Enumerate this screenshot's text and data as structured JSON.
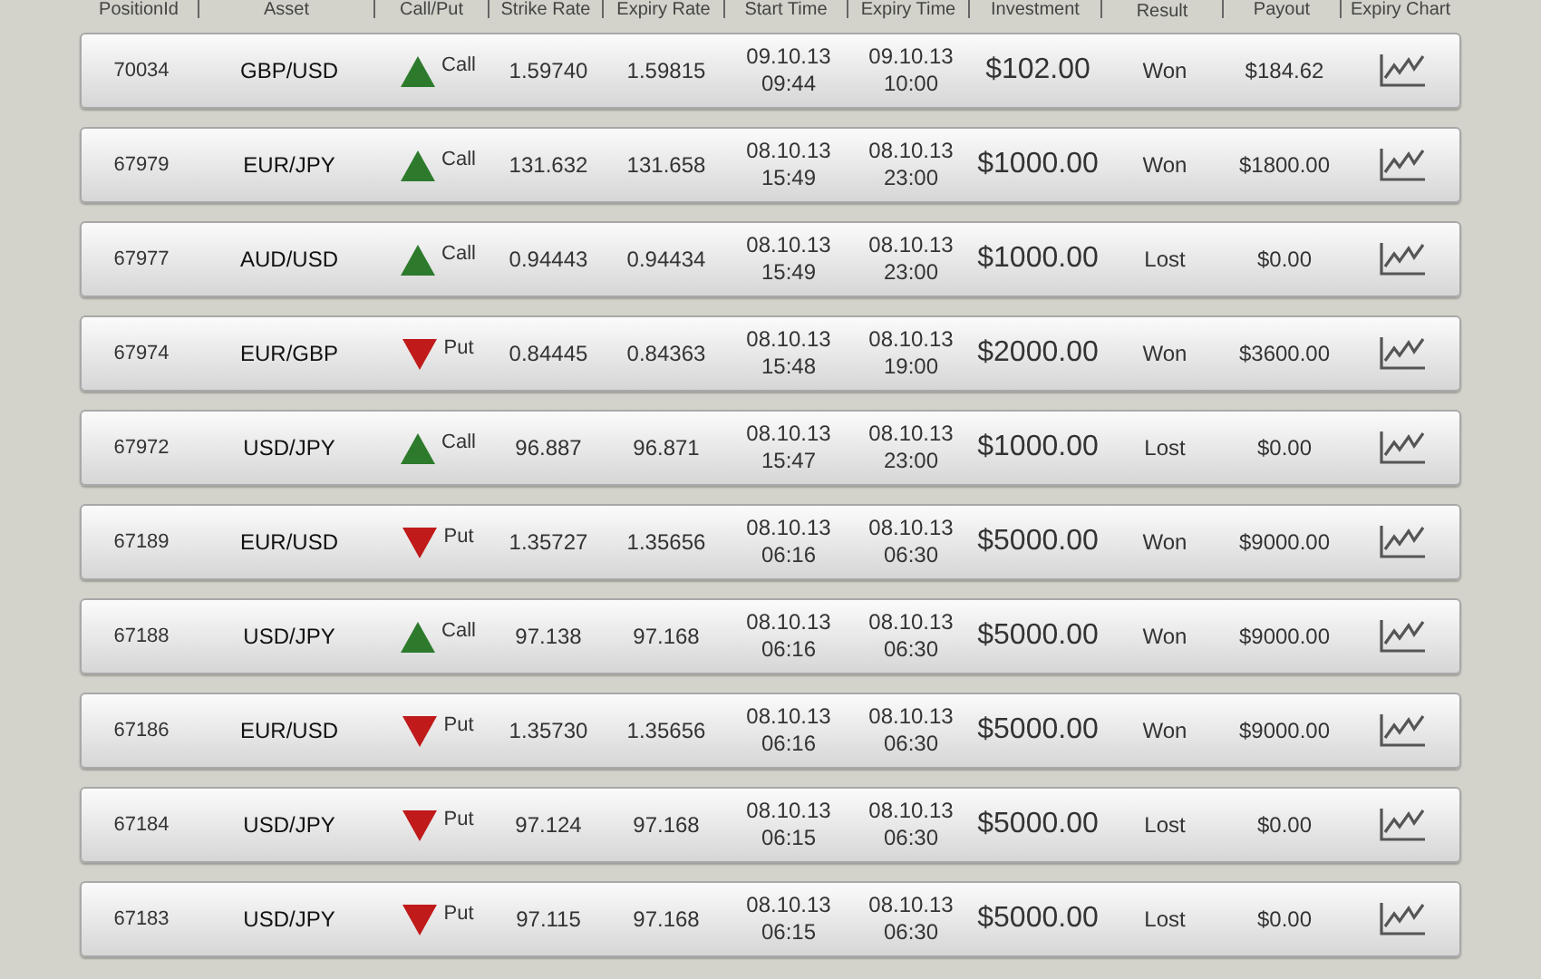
{
  "table": {
    "columns": [
      "PositionId",
      "Asset",
      "Call/Put",
      "Strike Rate",
      "Expiry Rate",
      "Start Time",
      "Expiry Time",
      "Investment",
      "Result",
      "Payout",
      "Expiry Chart"
    ],
    "rows": [
      {
        "position_id": "70034",
        "asset": "GBP/USD",
        "kind": "call",
        "direction_label": "Call",
        "strike_rate": "1.59740",
        "expiry_rate": "1.59815",
        "start_date": "09.10.13",
        "start_time": "09:44",
        "expiry_date": "09.10.13",
        "expiry_time": "10:00",
        "investment": "$102.00",
        "result": "Won",
        "payout": "$184.62"
      },
      {
        "position_id": "67979",
        "asset": "EUR/JPY",
        "kind": "call",
        "direction_label": "Call",
        "strike_rate": "131.632",
        "expiry_rate": "131.658",
        "start_date": "08.10.13",
        "start_time": "15:49",
        "expiry_date": "08.10.13",
        "expiry_time": "23:00",
        "investment": "$1000.00",
        "result": "Won",
        "payout": "$1800.00"
      },
      {
        "position_id": "67977",
        "asset": "AUD/USD",
        "kind": "call",
        "direction_label": "Call",
        "strike_rate": "0.94443",
        "expiry_rate": "0.94434",
        "start_date": "08.10.13",
        "start_time": "15:49",
        "expiry_date": "08.10.13",
        "expiry_time": "23:00",
        "investment": "$1000.00",
        "result": "Lost",
        "payout": "$0.00"
      },
      {
        "position_id": "67974",
        "asset": "EUR/GBP",
        "kind": "put",
        "direction_label": "Put",
        "strike_rate": "0.84445",
        "expiry_rate": "0.84363",
        "start_date": "08.10.13",
        "start_time": "15:48",
        "expiry_date": "08.10.13",
        "expiry_time": "19:00",
        "investment": "$2000.00",
        "result": "Won",
        "payout": "$3600.00"
      },
      {
        "position_id": "67972",
        "asset": "USD/JPY",
        "kind": "call",
        "direction_label": "Call",
        "strike_rate": "96.887",
        "expiry_rate": "96.871",
        "start_date": "08.10.13",
        "start_time": "15:47",
        "expiry_date": "08.10.13",
        "expiry_time": "23:00",
        "investment": "$1000.00",
        "result": "Lost",
        "payout": "$0.00"
      },
      {
        "position_id": "67189",
        "asset": "EUR/USD",
        "kind": "put",
        "direction_label": "Put",
        "strike_rate": "1.35727",
        "expiry_rate": "1.35656",
        "start_date": "08.10.13",
        "start_time": "06:16",
        "expiry_date": "08.10.13",
        "expiry_time": "06:30",
        "investment": "$5000.00",
        "result": "Won",
        "payout": "$9000.00"
      },
      {
        "position_id": "67188",
        "asset": "USD/JPY",
        "kind": "call",
        "direction_label": "Call",
        "strike_rate": "97.138",
        "expiry_rate": "97.168",
        "start_date": "08.10.13",
        "start_time": "06:16",
        "expiry_date": "08.10.13",
        "expiry_time": "06:30",
        "investment": "$5000.00",
        "result": "Won",
        "payout": "$9000.00"
      },
      {
        "position_id": "67186",
        "asset": "EUR/USD",
        "kind": "put",
        "direction_label": "Put",
        "strike_rate": "1.35730",
        "expiry_rate": "1.35656",
        "start_date": "08.10.13",
        "start_time": "06:16",
        "expiry_date": "08.10.13",
        "expiry_time": "06:30",
        "investment": "$5000.00",
        "result": "Won",
        "payout": "$9000.00"
      },
      {
        "position_id": "67184",
        "asset": "USD/JPY",
        "kind": "put",
        "direction_label": "Put",
        "strike_rate": "97.124",
        "expiry_rate": "97.168",
        "start_date": "08.10.13",
        "start_time": "06:15",
        "expiry_date": "08.10.13",
        "expiry_time": "06:30",
        "investment": "$5000.00",
        "result": "Lost",
        "payout": "$0.00"
      },
      {
        "position_id": "67183",
        "asset": "USD/JPY",
        "kind": "put",
        "direction_label": "Put",
        "strike_rate": "97.115",
        "expiry_rate": "97.168",
        "start_date": "08.10.13",
        "start_time": "06:15",
        "expiry_date": "08.10.13",
        "expiry_time": "06:30",
        "investment": "$5000.00",
        "result": "Lost",
        "payout": "$0.00"
      }
    ]
  }
}
